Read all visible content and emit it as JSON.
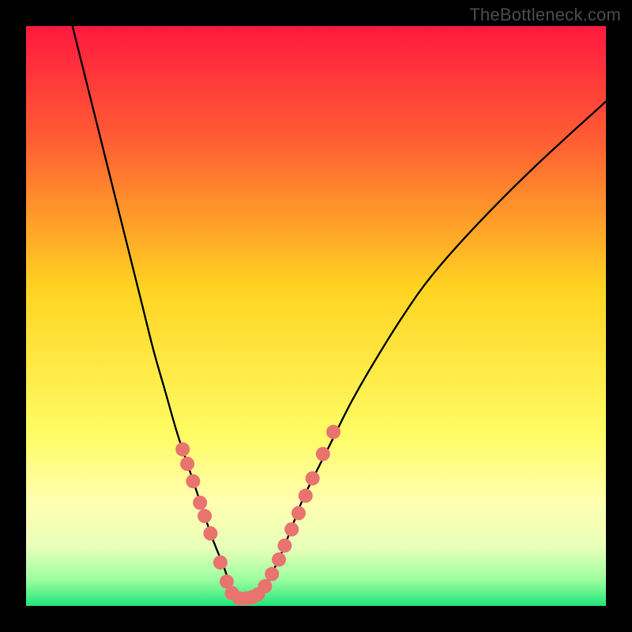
{
  "attribution": "TheBottleneck.com",
  "chart_data": {
    "type": "line",
    "title": "",
    "xlabel": "",
    "ylabel": "",
    "xlim": [
      0,
      100
    ],
    "ylim": [
      0,
      100
    ],
    "optimum_x": 37,
    "gradient_stops": [
      {
        "offset": 0.0,
        "color": "#ff193f"
      },
      {
        "offset": 0.2,
        "color": "#ff5f33"
      },
      {
        "offset": 0.45,
        "color": "#ffd321"
      },
      {
        "offset": 0.7,
        "color": "#fffb63"
      },
      {
        "offset": 0.82,
        "color": "#ffffb0"
      },
      {
        "offset": 0.9,
        "color": "#e7ffb8"
      },
      {
        "offset": 0.955,
        "color": "#9cff9e"
      },
      {
        "offset": 1.0,
        "color": "#20e47a"
      }
    ],
    "series": [
      {
        "name": "bottleneck-curve",
        "x": [
          8,
          10,
          12,
          14,
          16,
          18,
          20,
          22,
          24,
          26,
          28,
          30,
          32,
          34,
          35.5,
          37,
          38.5,
          40,
          42,
          44,
          46,
          48,
          52,
          56,
          60,
          65,
          70,
          78,
          88,
          100
        ],
        "y": [
          100,
          92,
          84,
          76,
          68,
          60,
          52,
          44,
          37,
          30,
          24,
          18,
          12,
          7,
          3,
          1.5,
          1.8,
          2.5,
          5,
          9,
          14,
          19,
          27,
          35,
          42,
          50,
          57,
          66,
          76,
          87
        ]
      }
    ],
    "markers": {
      "name": "sample-points",
      "color": "#e9736f",
      "radius": 9,
      "points": [
        {
          "x": 27.0,
          "y": 27.0
        },
        {
          "x": 27.8,
          "y": 24.5
        },
        {
          "x": 28.8,
          "y": 21.5
        },
        {
          "x": 30.0,
          "y": 17.8
        },
        {
          "x": 30.8,
          "y": 15.5
        },
        {
          "x": 31.8,
          "y": 12.5
        },
        {
          "x": 33.5,
          "y": 7.5
        },
        {
          "x": 34.6,
          "y": 4.2
        },
        {
          "x": 35.5,
          "y": 2.2
        },
        {
          "x": 36.8,
          "y": 1.3
        },
        {
          "x": 38.0,
          "y": 1.3
        },
        {
          "x": 39.0,
          "y": 1.5
        },
        {
          "x": 40.0,
          "y": 2.0
        },
        {
          "x": 41.2,
          "y": 3.4
        },
        {
          "x": 42.4,
          "y": 5.5
        },
        {
          "x": 43.6,
          "y": 8.0
        },
        {
          "x": 44.6,
          "y": 10.4
        },
        {
          "x": 45.8,
          "y": 13.2
        },
        {
          "x": 47.0,
          "y": 16.0
        },
        {
          "x": 48.2,
          "y": 19.0
        },
        {
          "x": 49.4,
          "y": 22.0
        },
        {
          "x": 51.2,
          "y": 26.2
        },
        {
          "x": 53.0,
          "y": 30.0
        }
      ]
    }
  }
}
